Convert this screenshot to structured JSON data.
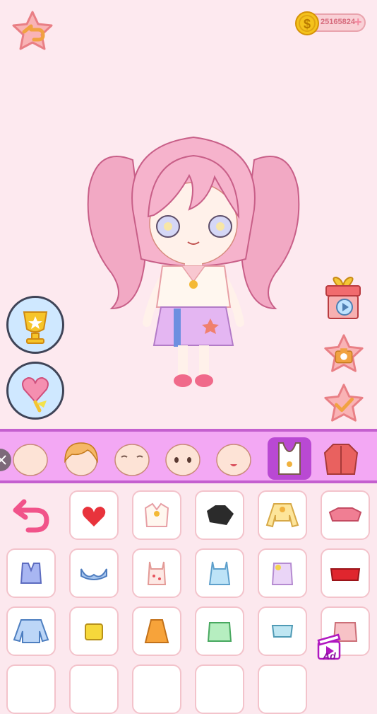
{
  "coins": {
    "amount": "25165824",
    "plus": "+"
  },
  "badge": {
    "ad_label": "Ad"
  },
  "categories": [
    "face-1",
    "hair",
    "face-2",
    "eyes",
    "mouth",
    "tops",
    "jackets"
  ],
  "active_category": "tops",
  "colors": {
    "accent": "#b949d3",
    "stage_bg": "#fde9ef",
    "category_bar": "#f3a8f4",
    "cell_border": "#f3c3cb"
  }
}
